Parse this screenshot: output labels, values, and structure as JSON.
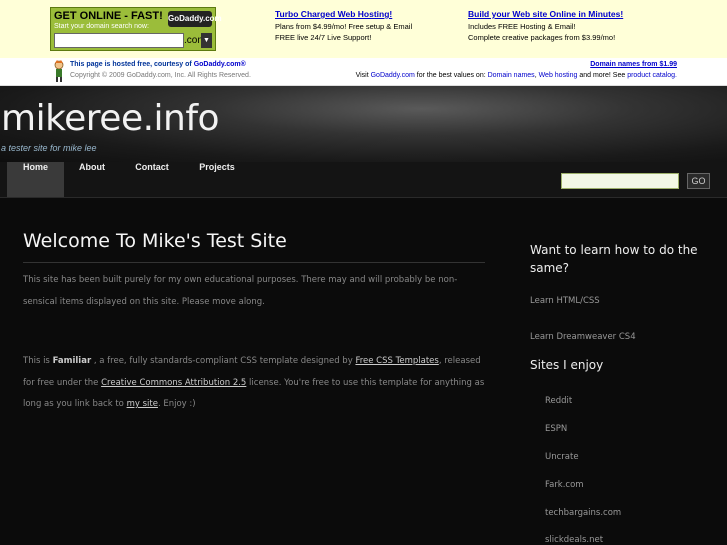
{
  "ad": {
    "godaddy": {
      "headline": "GET ONLINE - FAST!",
      "subline": "Start your domain search now:",
      "logo": "GoDaddy.com",
      "tld": ".com"
    },
    "col1": {
      "title": "Turbo Charged Web Hosting!",
      "lines": [
        "Plans from $4.99/mo! Free setup & Email",
        "FREE live 24/7 Live Support!"
      ]
    },
    "col2": {
      "title": "Build your Web site Online in Minutes!",
      "lines": [
        "Includes FREE Hosting & Email!",
        "Complete creative packages from $3.99/mo!"
      ]
    }
  },
  "hosted": {
    "line1_prefix": "This page is hosted free, courtesy of ",
    "line1_link": "GoDaddy.com®",
    "copyright": "Copyright © 2009 GoDaddy.com, Inc. All Rights Reserved.",
    "right_title": "Domain names from $1.99",
    "right_pre": "Visit ",
    "right_link1": "GoDaddy.com",
    "right_mid": " for the best values on: ",
    "right_link2": "Domain names",
    "right_sep": ", ",
    "right_link3": "Web hosting",
    "right_mid2": " and more! See ",
    "right_link4": "product catalog."
  },
  "header": {
    "title": "mikeree.info",
    "tagline": "a tester site for mike lee"
  },
  "nav": {
    "items": [
      "Home",
      "About",
      "Contact",
      "Projects"
    ],
    "search_button": "GO"
  },
  "main": {
    "title": "Welcome To Mike's Test Site",
    "para1": "This site has been built purely for my own educational purposes. There may and will probably be non-sensical items displayed on this site. Please move along.",
    "p2_a": "This is ",
    "p2_b": "Familiar",
    "p2_c": " , a free, fully standards-compliant CSS template designed by ",
    "p2_link1": "Free CSS Templates",
    "p2_d": ", released for free under the ",
    "p2_link2": "Creative Commons Attribution 2.5",
    "p2_e": " license. You're free to use this template for anything as long as you link back to ",
    "p2_link3": "my site",
    "p2_f": ". Enjoy :)"
  },
  "sidebar": {
    "heading1": "Want to learn how to do the same?",
    "learn": [
      "Learn HTML/CSS",
      "Learn Dreamweaver CS4"
    ],
    "heading2": "Sites I enjoy",
    "sites": [
      "Reddit",
      "ESPN",
      "Uncrate",
      "Fark.com",
      "techbargains.com",
      "slickdeals.net"
    ]
  }
}
